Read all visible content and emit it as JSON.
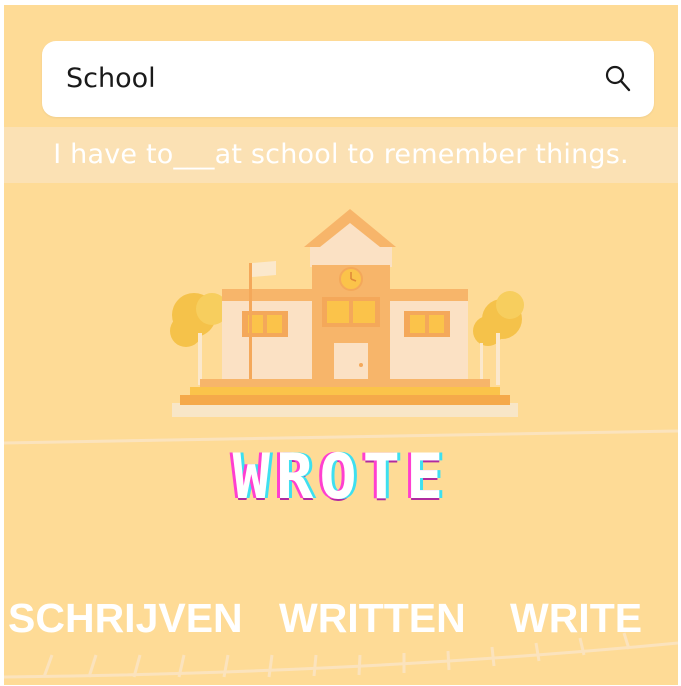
{
  "search": {
    "value": "School"
  },
  "sentence": "I have to___at school to remember things.",
  "answer": "WROTE",
  "options": [
    "SCHRIJVEN",
    "WRITTEN",
    "WRITE"
  ],
  "colors": {
    "background": "#fedb96",
    "band": "#fbe1b4",
    "answer_glow_pink": "#ff3fd0",
    "answer_glow_cyan": "#3ee0f0"
  }
}
